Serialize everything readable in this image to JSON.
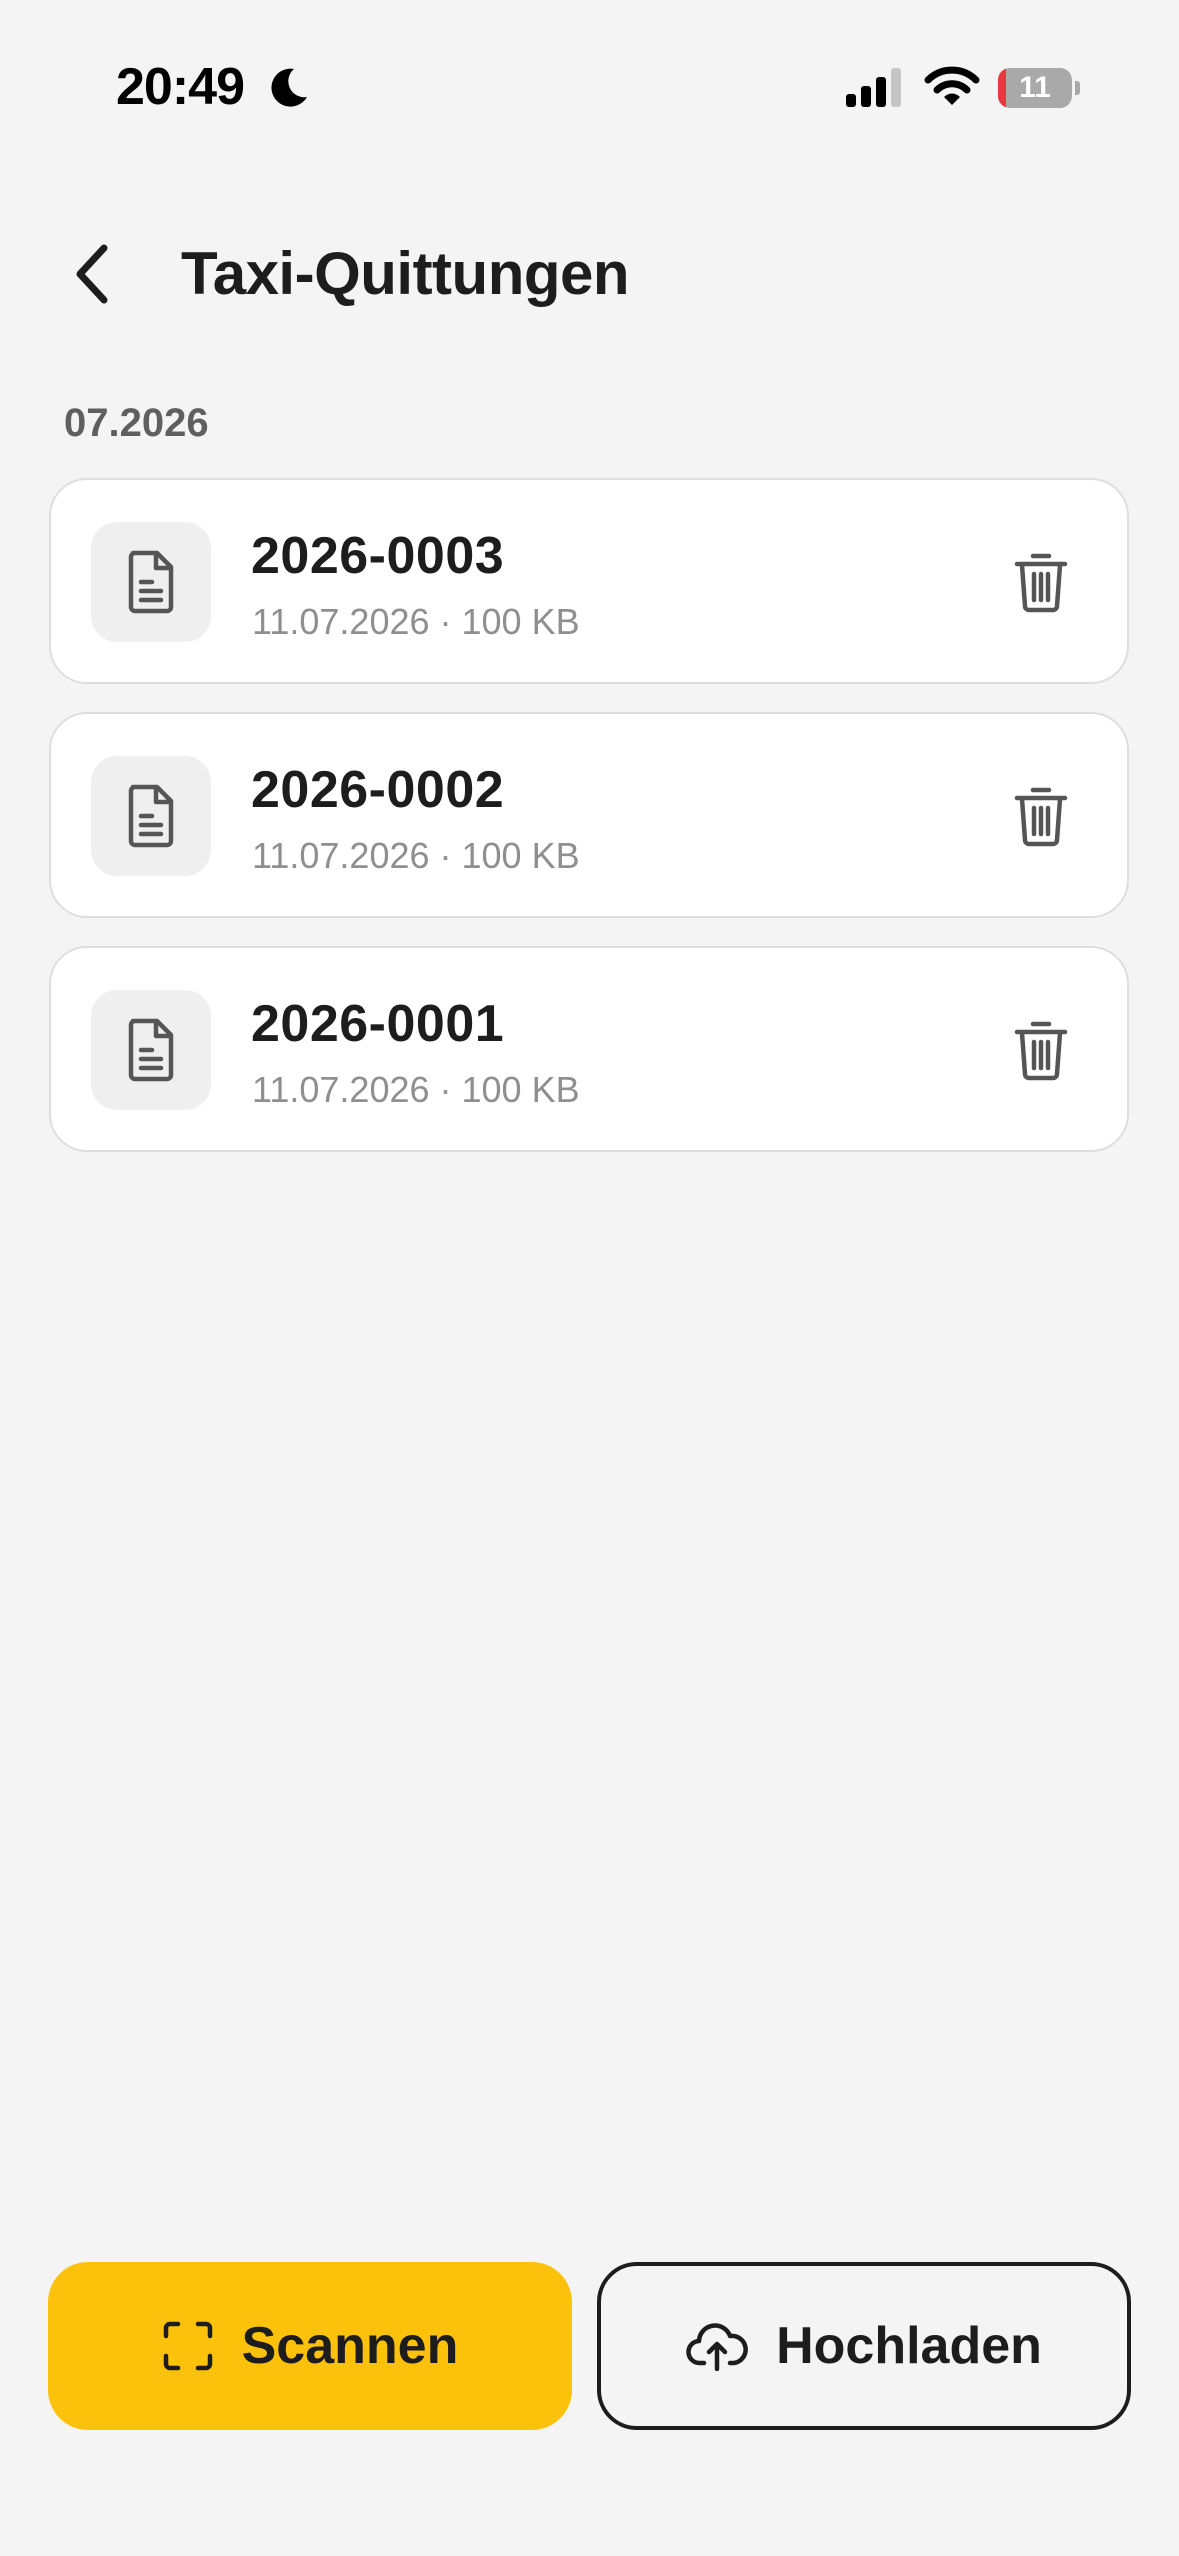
{
  "status_bar": {
    "time": "20:49",
    "battery_level": "11",
    "moon_icon": "moon-icon",
    "signal_icon": "cellular-signal-icon",
    "wifi_icon": "wifi-icon"
  },
  "header": {
    "back_icon": "chevron-left-icon",
    "title": "Taxi-Quittungen"
  },
  "section": {
    "label": "07.2026"
  },
  "files": [
    {
      "name": "2026-0003",
      "meta": "11.07.2026 · 100 KB",
      "icon": "document-icon",
      "delete_icon": "trash-icon"
    },
    {
      "name": "2026-0002",
      "meta": "11.07.2026 · 100 KB",
      "icon": "document-icon",
      "delete_icon": "trash-icon"
    },
    {
      "name": "2026-0001",
      "meta": "11.07.2026 · 100 KB",
      "icon": "document-icon",
      "delete_icon": "trash-icon"
    }
  ],
  "actions": {
    "scan_label": "Scannen",
    "scan_icon": "scan-frame-icon",
    "upload_label": "Hochladen",
    "upload_icon": "cloud-upload-icon"
  },
  "colors": {
    "accent": "#fcc10b",
    "background": "#f4f4f4",
    "card": "#ffffff",
    "text": "#1d1d1d",
    "muted": "#8f8f8f",
    "battery_low": "#e5393f"
  }
}
